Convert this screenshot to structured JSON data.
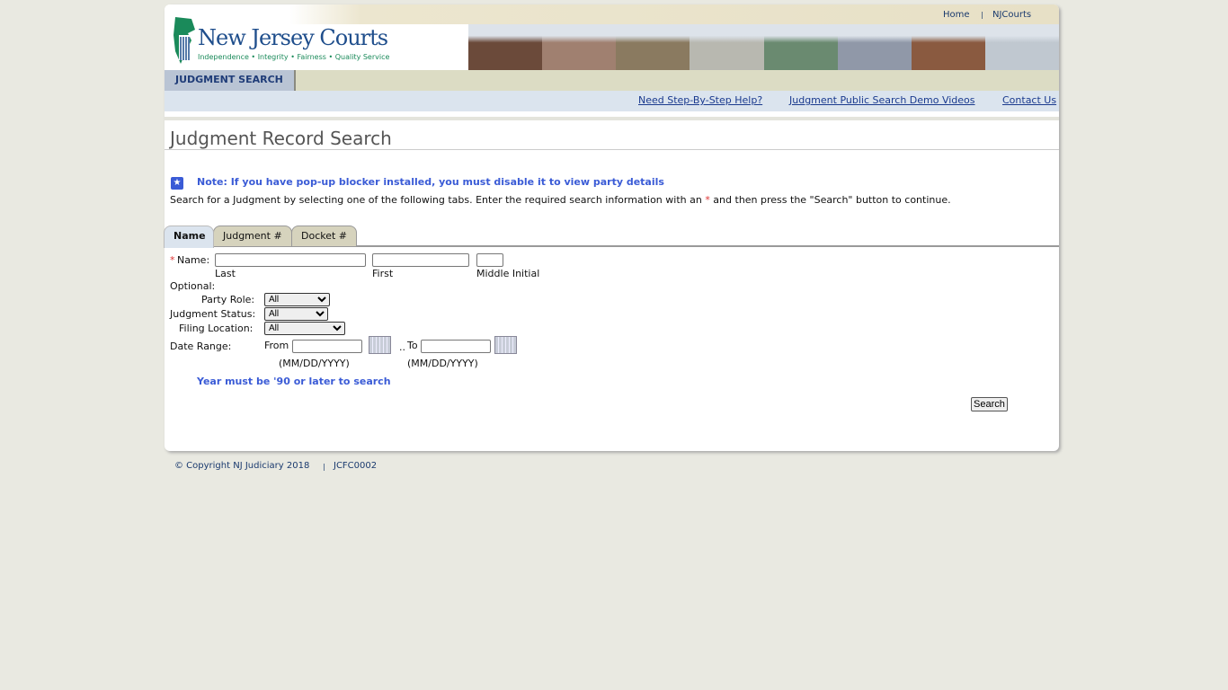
{
  "header": {
    "brand": "New Jersey Courts",
    "tagline": "Independence • Integrity • Fairness • Quality Service",
    "top_links": [
      "Home",
      "NJCourts"
    ],
    "photo_colors": [
      "#6b4a3a",
      "#a08070",
      "#8a7a60",
      "#b8b8b0",
      "#6a8a70",
      "#9098a8",
      "#8a5a40",
      "#c0c8d0"
    ]
  },
  "nav": {
    "active": "JUDGMENT SEARCH"
  },
  "help_links": [
    "Need Step-By-Step Help?",
    "Judgment Public Search Demo Videos",
    "Contact Us"
  ],
  "page": {
    "title": "Judgment Record Search",
    "note": "Note: If you have pop-up blocker installed, you must disable it to view party details",
    "intro_before": "Search for a Judgment by selecting one of the following tabs. Enter the required search information with an ",
    "asterisk": "*",
    "intro_after": " and then press the \"Search\" button to continue."
  },
  "tabs": [
    "Name",
    "Judgment #",
    "Docket #"
  ],
  "form": {
    "name_label": "Name:",
    "last": "Last",
    "first": "First",
    "middle": "Middle Initial",
    "optional": "Optional:",
    "party_role_label": "Party Role:",
    "party_role": "All",
    "status_label": "Judgment Status:",
    "status": "All",
    "location_label": "Filing Location:",
    "location": "All",
    "date_label": "Date Range:",
    "from": "From",
    "to": "To",
    "date_fmt": "(MM/DD/YYYY)",
    "year_note": "Year must be '90 or later to search",
    "search": "Search"
  },
  "footer": {
    "copyright": "© Copyright NJ Judiciary 2018",
    "code": "JCFC0002"
  },
  "colors": {
    "accent": "#3a5bd6",
    "brand": "#1f4e8c",
    "green": "#1a8a5a"
  }
}
